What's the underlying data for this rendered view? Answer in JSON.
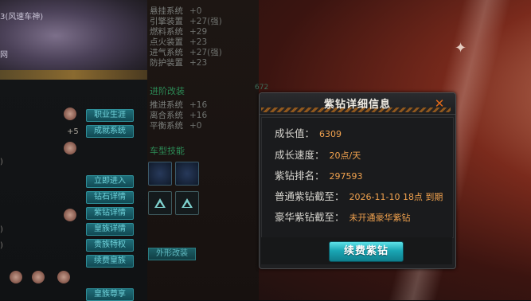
{
  "dialog": {
    "title": "紫钻详细信息",
    "close_label": "✕",
    "rows": [
      {
        "label": "成长值：",
        "value": "6309"
      },
      {
        "label": "成长速度：",
        "value": "20点/天"
      },
      {
        "label": "紫钻排名：",
        "value": "297593"
      },
      {
        "label": "普通紫钻截至：",
        "value": "2026-11-10 18点 到期"
      },
      {
        "label": "豪华紫钻截至：",
        "value": "未开通豪华紫钻"
      }
    ],
    "renew_button": "续费紫钻"
  },
  "background": {
    "left_top_text": "3(风速车神)",
    "left_top_text2": "网",
    "left_plus": "+5",
    "systems_top": [
      {
        "name": "悬挂系统",
        "value": "+0"
      },
      {
        "name": "引擎装置",
        "value": "+27(强)"
      },
      {
        "name": "燃料系统",
        "value": "+29"
      },
      {
        "name": "点火装置",
        "value": "+23"
      },
      {
        "name": "进气系统",
        "value": "+27(强)"
      },
      {
        "name": "防护装置",
        "value": "+23"
      }
    ],
    "section_advanced": "进阶改装",
    "systems_bottom": [
      {
        "name": "推进系统",
        "value": "+16"
      },
      {
        "name": "离合系统",
        "value": "+16"
      },
      {
        "name": "平衡系统",
        "value": "+0"
      }
    ],
    "section_skill": "车型技能",
    "left_buttons": [
      "职业生涯",
      "成就系统",
      "立即进入",
      "钻石详情",
      "紫钻详情",
      "皇族详情",
      "贵族特权",
      "续费皇族",
      "皇族尊享"
    ],
    "bottom_green_button": "外形改装",
    "faint_number": "672"
  },
  "colors": {
    "accent_orange": "#f1a24e",
    "close_orange": "#e06818",
    "button_cyan": "#1aa6b4"
  }
}
